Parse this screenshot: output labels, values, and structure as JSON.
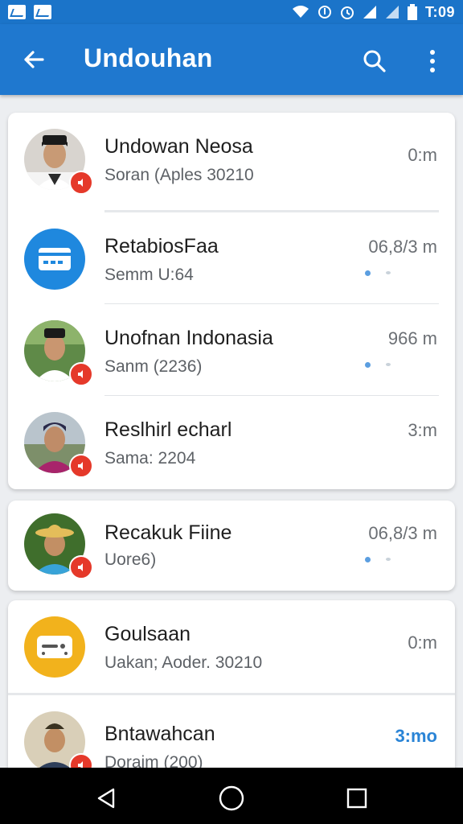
{
  "status_bar": {
    "time": "T:09",
    "icons": [
      "image-notification-icon",
      "gallery-notification-icon",
      "wifi-icon",
      "data-saver-icon",
      "alarm-icon",
      "signal-icon",
      "signal-icon",
      "battery-icon"
    ]
  },
  "app_bar": {
    "title": "Undouhan",
    "back_icon": "arrow-back-icon",
    "search_icon": "search-icon",
    "menu_icon": "more-vert-icon",
    "color": "#1f78cf"
  },
  "chats": [
    {
      "name": "Undowan Neosa",
      "subtitle": "Soran (Aples 30210",
      "time": "0:m",
      "avatar": "person-photo",
      "badge": true,
      "dots": false
    },
    {
      "name": "RetabiosFaa",
      "subtitle": "Semm U:64",
      "time": "06,8/3 m",
      "avatar": "card-icon",
      "badge": false,
      "dots": true
    },
    {
      "name": "Unofnan Indonasia",
      "subtitle": "Sanm (2236)",
      "time": "966 m",
      "avatar": "person-photo",
      "badge": true,
      "dots": true
    },
    {
      "name": "Reslhirl echarl",
      "subtitle": "Sama: 2204",
      "time": "3:m",
      "avatar": "person-photo",
      "badge": true,
      "dots": false
    },
    {
      "name": "Recakuk Fiine",
      "subtitle": "Uore6)",
      "time": "06,8/3 m",
      "avatar": "person-photo",
      "badge": true,
      "dots": true
    },
    {
      "name": "Goulsaan",
      "subtitle": "Uakan; Aoder. 30210",
      "time": "0:m",
      "avatar": "message-icon",
      "badge": false,
      "dots": false
    },
    {
      "name": "Bntawahcan",
      "subtitle": "Doraim (200)",
      "time": "3:mo",
      "avatar": "person-photo",
      "badge": true,
      "dots": false,
      "time_highlight": true
    }
  ],
  "colors": {
    "accent": "#1f78cf",
    "badge": "#e5392a",
    "card_icon_bg": "#1f88de",
    "message_icon_bg": "#f2b21c"
  },
  "nav_bar": {
    "back": "nav-back-icon",
    "home": "nav-home-icon",
    "recents": "nav-recents-icon"
  }
}
